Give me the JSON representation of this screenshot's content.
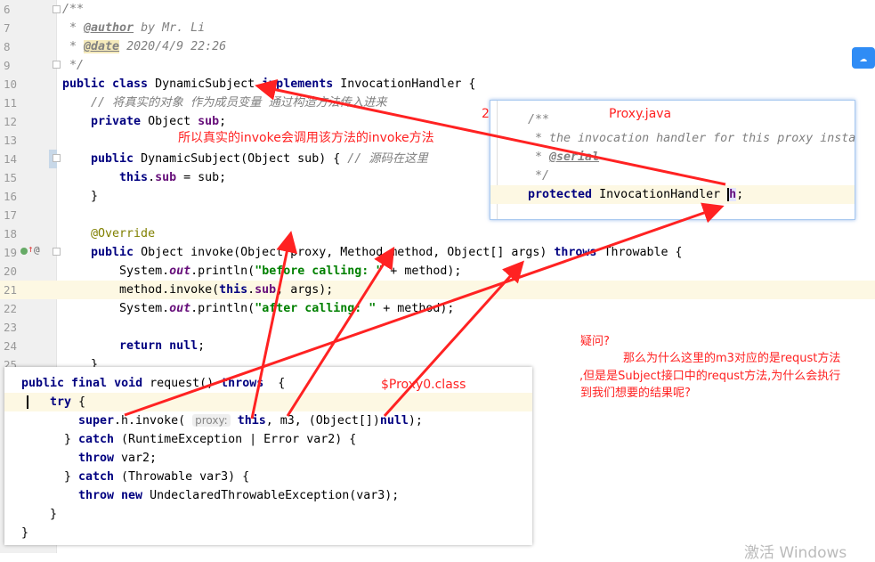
{
  "editor": {
    "line_numbers": [
      "6",
      "7",
      "8",
      "9",
      "10",
      "11",
      "12",
      "13",
      "14",
      "15",
      "16",
      "17",
      "18",
      "19",
      "20",
      "21",
      "22",
      "23",
      "24",
      "25"
    ],
    "lines": {
      "l6": "/**",
      "l7_star": " * ",
      "l7_tag": "@author",
      "l7_rest": " by Mr. Li",
      "l8_star": " * ",
      "l8_tag": "@date",
      "l8_rest": " 2020/4/9 22:26",
      "l9": " */",
      "l10_kw": "public class ",
      "l10_a": "DynamicSubject ",
      "l10_kw2": "implements ",
      "l10_b": "InvocationHandler {",
      "l11": "    // 将真实的对象 作为成员变量 通过构造方法传入进来",
      "l12_kw": "    private ",
      "l12_a": "Object ",
      "l12_f": "sub",
      "l12_b": ";",
      "l14_kw": "    public ",
      "l14_a": "DynamicSubject(Object sub) { ",
      "l14_c": "// 源码在这里",
      "l15_kw": "        this",
      "l15_a": ".",
      "l15_f": "sub",
      "l15_b": " = sub;",
      "l16": "    }",
      "l18": "    @Override",
      "l19_kw": "    public ",
      "l19_a": "Object invoke(Object proxy, Method method, Object[] args) ",
      "l19_kw2": "throws ",
      "l19_b": "Throwable {",
      "l20_a": "        System.",
      "l20_s": "out",
      "l20_b": ".println(",
      "l20_str": "\"before calling: \"",
      "l20_c": " + method);",
      "l21_a": "        method.invoke(",
      "l21_kw": "this",
      "l21_b": ".",
      "l21_f": "sub",
      "l21_c": ", args);",
      "l22_a": "        System.",
      "l22_s": "out",
      "l22_b": ".println(",
      "l22_str": "\"after calling: \"",
      "l22_c": " + method);",
      "l24_kw": "        return null",
      "l24_a": ";",
      "l25": "    }"
    },
    "gutter_icons": [
      "implements-method-icon",
      "override-arrow-icon",
      "annotation-icon"
    ]
  },
  "proxy_popup": {
    "title": "Proxy.java",
    "l1": "/**",
    "l2": " * the invocation handler for this proxy insta",
    "l3_star": " * ",
    "l3_tag": "@serial",
    "l4": " */",
    "l5_kw": "protected ",
    "l5_a": "InvocationHandler ",
    "l5_f": "h",
    "l5_b": ";"
  },
  "proxy0_popup": {
    "title": "$Proxy0.class",
    "l1_kw": "public final void ",
    "l1_a": "request() ",
    "l1_kw2": "throws ",
    "l1_b": " {",
    "l2_kw": "try",
    "l2_a": " {",
    "l3_kw": "super",
    "l3_a": ".h.invoke( ",
    "l3_hint": "proxy:",
    "l3_kw2": " this",
    "l3_b": ", m3, (Object[])",
    "l3_kw3": "null",
    "l3_c": ");",
    "l4_a": "} ",
    "l4_kw": "catch",
    "l4_b": " (RuntimeException | Error var2) {",
    "l5_kw": "throw",
    "l5_a": " var2;",
    "l6_a": "} ",
    "l6_kw": "catch",
    "l6_b": " (Throwable var3) {",
    "l7_kw": "throw new",
    "l7_a": " UndeclaredThrowableException(var3);",
    "l8": "}",
    "l9": "}"
  },
  "annotations": {
    "note1": "所以真实的invoke会调用该方法的invoke方法",
    "number": "2",
    "question_title": "疑问?",
    "question_l1": "那么为什么这里的m3对应的是requst方法",
    "question_l2": ",但是是Subject接口中的requst方法,为什么会执行",
    "question_l3": "到我们想要的结果呢?",
    "color": "#ff2020"
  },
  "cloud_icon": "baidu-cloud-icon",
  "watermark": "激活 Windows"
}
